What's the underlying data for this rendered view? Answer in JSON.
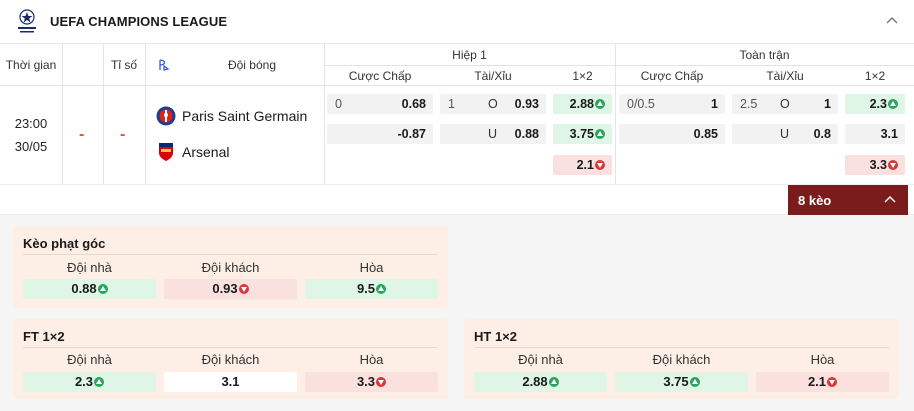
{
  "league": {
    "name": "UEFA CHAMPIONS LEAGUE",
    "logo_icon": "champions-league-logo"
  },
  "headers": {
    "time": "Thời gian",
    "score": "Tỉ số",
    "team": "Đội bóng",
    "half1": "Hiệp 1",
    "fulltime": "Toàn trận",
    "handicap": "Cược Chấp",
    "overunder": "Tài/Xỉu",
    "onextwo": "1×2"
  },
  "match": {
    "time": "23:00",
    "date": "30/05",
    "home_score": "-",
    "away_score": "-",
    "home_team": "Paris Saint Germain",
    "away_team": "Arsenal",
    "half1": {
      "handicap": [
        {
          "line": "0",
          "odd": "0.68"
        },
        {
          "line": "",
          "odd": "-0.87"
        }
      ],
      "overunder": [
        {
          "line": "1",
          "side": "O",
          "odd": "0.93"
        },
        {
          "line": "",
          "side": "U",
          "odd": "0.88"
        }
      ],
      "onextwo": [
        {
          "odd": "2.88",
          "trend": "up"
        },
        {
          "odd": "3.75",
          "trend": "up"
        },
        {
          "odd": "2.1",
          "trend": "down"
        }
      ]
    },
    "fulltime": {
      "handicap": [
        {
          "line": "0/0.5",
          "odd": "1"
        },
        {
          "line": "",
          "odd": "0.85"
        }
      ],
      "overunder": [
        {
          "line": "2.5",
          "side": "O",
          "odd": "1"
        },
        {
          "line": "",
          "side": "U",
          "odd": "0.8"
        }
      ],
      "onextwo": [
        {
          "odd": "2.3",
          "trend": "up"
        },
        {
          "odd": "3.1",
          "trend": "none"
        },
        {
          "odd": "3.3",
          "trend": "down"
        }
      ]
    }
  },
  "more_bets": {
    "label": "8 kèo"
  },
  "cards": {
    "corners": {
      "title": "Kèo phạt góc",
      "labels": [
        "Đội nhà",
        "Đội khách",
        "Hòa"
      ],
      "odds": [
        "0.88",
        "0.93",
        "9.5"
      ]
    },
    "ft": {
      "title": "FT 1×2",
      "labels": [
        "Đội nhà",
        "Đội khách",
        "Hòa"
      ],
      "odds": [
        "2.3",
        "3.1",
        "3.3"
      ]
    },
    "ht": {
      "title": "HT 1×2",
      "labels": [
        "Đội nhà",
        "Đội khách",
        "Hòa"
      ],
      "odds": [
        "2.88",
        "3.75",
        "2.1"
      ]
    }
  },
  "colors": {
    "up": "#2aa55b",
    "down": "#d93838",
    "accent": "#7a1c1c",
    "card_bg": "#fdeee6"
  }
}
